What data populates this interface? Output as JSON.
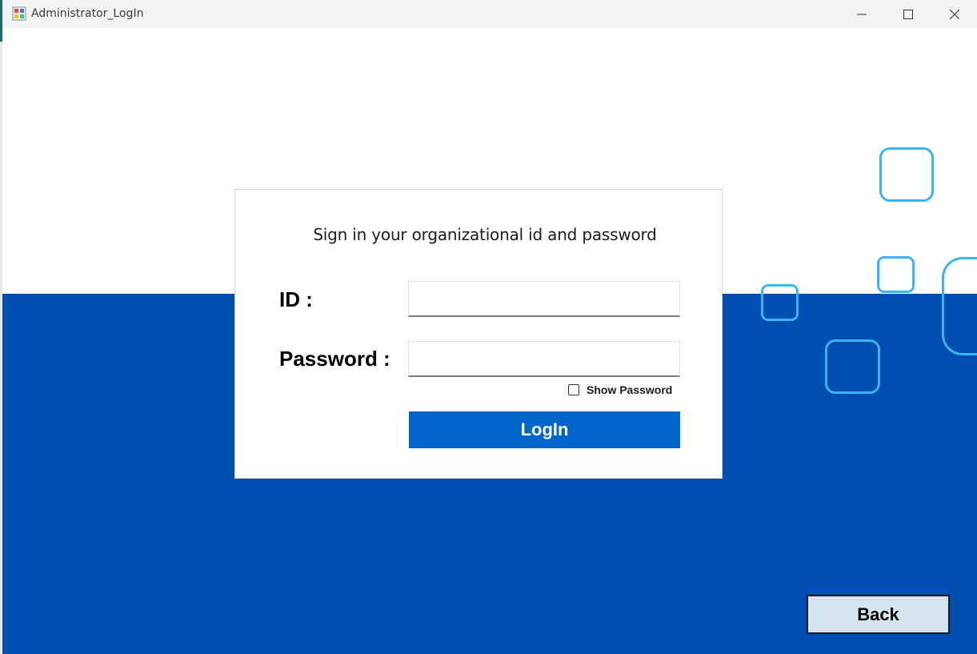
{
  "window": {
    "title": "Administrator_LogIn",
    "controls": {
      "minimize_icon": "minimize-icon",
      "maximize_icon": "maximize-icon",
      "close_icon": "close-icon"
    }
  },
  "login_card": {
    "heading": "Sign in your organizational id and password",
    "id_label": "ID :",
    "id_value": "",
    "password_label": "Password :",
    "password_value": "",
    "show_password_label": "Show Password",
    "show_password_checked": false,
    "login_button": "LogIn"
  },
  "back_button": "Back",
  "colors": {
    "band_blue": "#004fb0",
    "login_button_blue": "#0066cc",
    "decoration_cyan": "#3db3f1",
    "back_button_bg": "#d6e3f0"
  }
}
